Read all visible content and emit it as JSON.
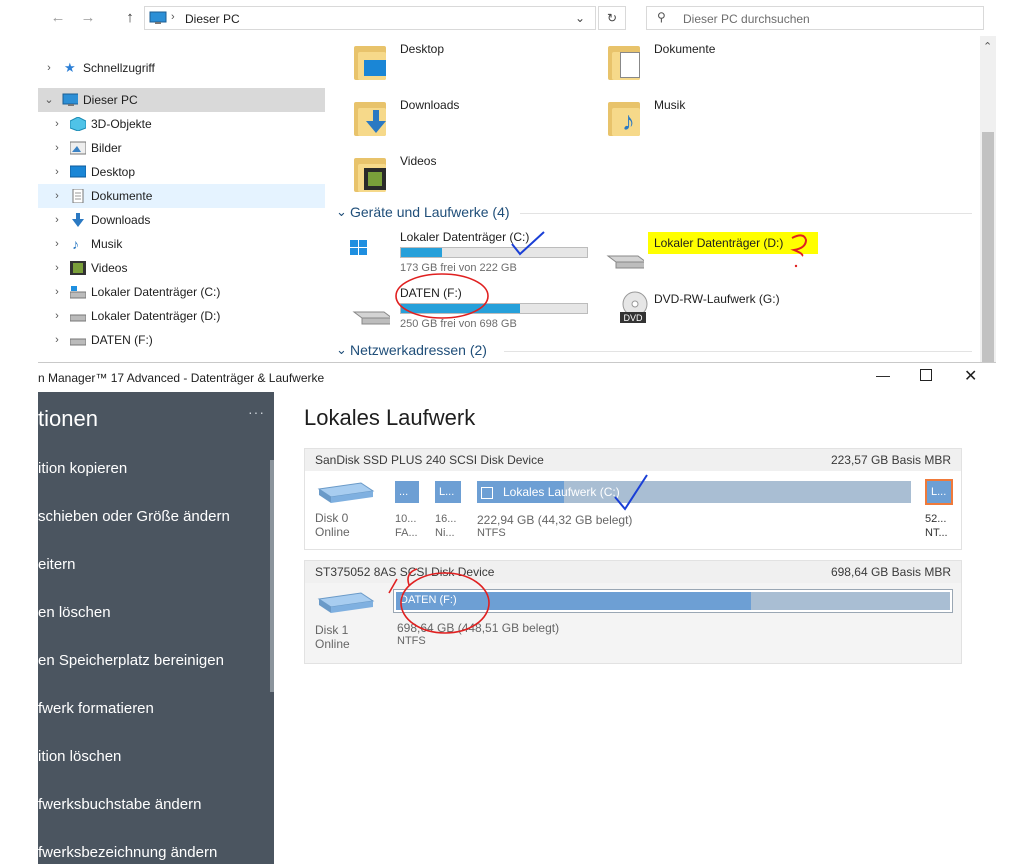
{
  "explorer": {
    "address": "Dieser PC",
    "search_placeholder": "Dieser PC durchsuchen",
    "tree": [
      {
        "label": "Schnellzugriff",
        "icon": "star-icon"
      },
      {
        "label": "Dieser PC",
        "icon": "pc-icon"
      },
      {
        "label": "3D-Objekte",
        "icon": "cube-icon"
      },
      {
        "label": "Bilder",
        "icon": "picture-icon"
      },
      {
        "label": "Desktop",
        "icon": "desktop-icon"
      },
      {
        "label": "Dokumente",
        "icon": "document-icon"
      },
      {
        "label": "Downloads",
        "icon": "download-icon"
      },
      {
        "label": "Musik",
        "icon": "music-icon"
      },
      {
        "label": "Videos",
        "icon": "video-icon"
      },
      {
        "label": "Lokaler Datenträger (C:)",
        "icon": "drive-icon"
      },
      {
        "label": "Lokaler Datenträger (D:)",
        "icon": "drive-icon"
      },
      {
        "label": "DATEN (F:)",
        "icon": "drive-icon"
      }
    ],
    "folders": [
      {
        "label": "Desktop"
      },
      {
        "label": "Dokumente"
      },
      {
        "label": "Downloads"
      },
      {
        "label": "Musik"
      },
      {
        "label": "Videos"
      }
    ],
    "devices_header": "Geräte und Laufwerke (4)",
    "drives": [
      {
        "label": "Lokaler Datenträger (C:)",
        "sub": "173 GB frei von 222 GB",
        "used_fraction": 0.22
      },
      {
        "label": "Lokaler Datenträger (D:)",
        "sub": "",
        "used_fraction": null
      },
      {
        "label": "DATEN (F:)",
        "sub": "250 GB frei von 698 GB",
        "used_fraction": 0.64
      },
      {
        "label": "DVD-RW-Laufwerk (G:)",
        "sub": "",
        "used_fraction": null
      }
    ],
    "network_header": "Netzwerkadressen (2)",
    "highlight_color": "#ffff00"
  },
  "pm": {
    "title": "n Manager™ 17 Advanced - Datenträger & Laufwerke",
    "sidebar_title": "tionen",
    "sidebar_items": [
      "ition kopieren",
      "schieben oder Größe ändern",
      "eitern",
      "en löschen",
      "en Speicherplatz bereinigen",
      "fwerk formatieren",
      "ition löschen",
      "fwerksbuchstabe ändern",
      "fwerksbezeichnung ändern"
    ],
    "main_title": "Lokales Laufwerk",
    "disks": [
      {
        "name": "SanDisk SSD PLUS 240 SCSI Disk Device",
        "info": "223,57 GB Basis MBR",
        "label": "Disk 0",
        "status": "Online",
        "partitions": [
          {
            "tile": "...",
            "sub1": "10...",
            "sub2": "FA..."
          },
          {
            "tile": "L...",
            "sub1": "16...",
            "sub2": "Ni..."
          },
          {
            "tile": "Lokales Laufwerk (C:)",
            "sub1": "222,94 GB (44,32 GB belegt)",
            "sub2": "NTFS",
            "used_fraction": 0.2
          },
          {
            "tile": "L...",
            "sub1": "52...",
            "sub2": "NT..."
          }
        ]
      },
      {
        "name": "ST375052 8AS SCSI Disk Device",
        "info": "698,64 GB Basis MBR",
        "label": "Disk 1",
        "status": "Online",
        "partitions": [
          {
            "tile": "DATEN (F:)",
            "sub1": "698,64 GB (448,51 GB belegt)",
            "sub2": "NTFS",
            "used_fraction": 0.64
          }
        ]
      }
    ]
  }
}
